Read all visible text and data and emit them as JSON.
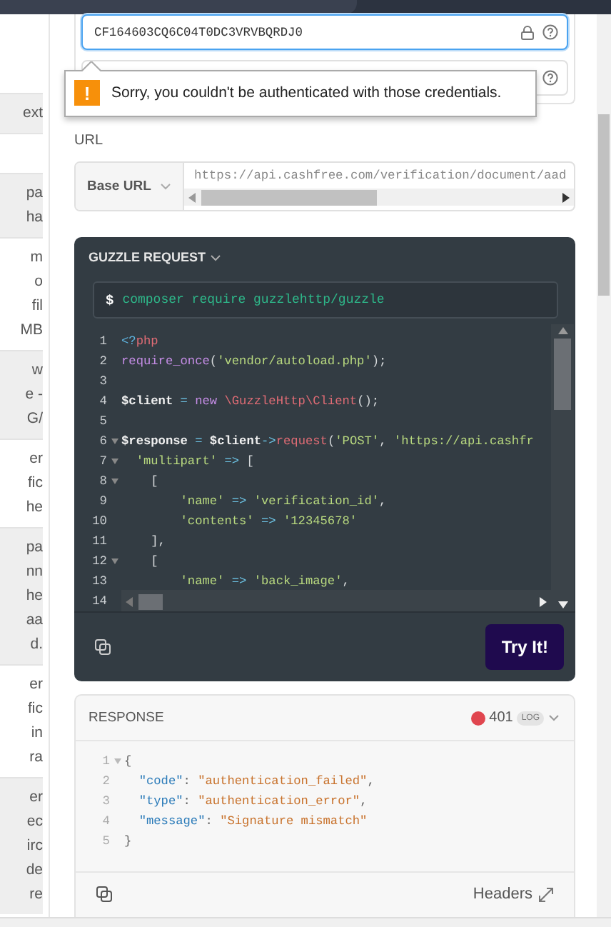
{
  "sidebar_fragments": [
    {
      "shaded": true,
      "lines": [
        "ext"
      ]
    },
    {
      "shaded": false
    },
    {
      "shaded": true,
      "lines": [
        "pa",
        "ha"
      ]
    },
    {
      "shaded": false,
      "lines": [
        "m",
        "o",
        "fil",
        "MB"
      ]
    },
    {
      "shaded": true,
      "lines": [
        "w",
        "e -",
        "G/"
      ]
    },
    {
      "shaded": false,
      "lines": [
        "er",
        "fic",
        "he"
      ]
    },
    {
      "shaded": true,
      "lines": [
        "pa",
        "nn",
        "he",
        "aa",
        "d."
      ]
    },
    {
      "shaded": false,
      "lines": [
        "er",
        "fic",
        "in",
        "ra"
      ]
    },
    {
      "shaded": true,
      "lines": [
        "er",
        "ec",
        "irc",
        "de",
        "re"
      ]
    }
  ],
  "credentials": {
    "fields": [
      {
        "value": "CF164603CQ6C04T0DC3VRVBQRDJ0",
        "focused": true,
        "locked": true
      },
      {
        "focused": false
      }
    ]
  },
  "error_tooltip": {
    "icon": "!",
    "message": "Sorry, you couldn't be authenticated with those credentials."
  },
  "url": {
    "label": "URL",
    "base_label": "Base URL",
    "value": "https://api.cashfree.com/verification/document/aad"
  },
  "request": {
    "title": "GUZZLE REQUEST",
    "prompt": "$",
    "command": "composer require guzzlehttp/guzzle",
    "button": "Try It!",
    "lines": [
      {
        "number": "1",
        "tokens": [
          {
            "kind": "tag",
            "text": "<?"
          },
          {
            "kind": "kw",
            "text": "php"
          }
        ]
      },
      {
        "number": "2",
        "tokens": [
          {
            "kind": "fn",
            "text": "require_once"
          },
          {
            "kind": "plain",
            "text": "("
          },
          {
            "kind": "str",
            "text": "'vendor/autoload.php'"
          },
          {
            "kind": "plain",
            "text": ");"
          }
        ]
      },
      {
        "number": "3"
      },
      {
        "number": "4",
        "tokens": [
          {
            "kind": "var",
            "text": "$client"
          },
          {
            "kind": "op",
            "text": " = "
          },
          {
            "kind": "fn",
            "text": "new"
          },
          {
            "kind": "kw",
            "text": " \\GuzzleHttp\\Client"
          },
          {
            "kind": "plain",
            "text": "();"
          }
        ]
      },
      {
        "number": "5"
      },
      {
        "number": "6",
        "foldable": true,
        "tokens": [
          {
            "kind": "var",
            "text": "$response"
          },
          {
            "kind": "op",
            "text": " = "
          },
          {
            "kind": "var",
            "text": "$client"
          },
          {
            "kind": "op",
            "text": "->"
          },
          {
            "kind": "kw",
            "text": "request"
          },
          {
            "kind": "plain",
            "text": "("
          },
          {
            "kind": "str",
            "text": "'POST'"
          },
          {
            "kind": "plain",
            "text": ", "
          },
          {
            "kind": "str",
            "text": "'https://api.cashfr"
          }
        ]
      },
      {
        "number": "7",
        "foldable": true,
        "tokens": [
          {
            "kind": "str",
            "text": "  'multipart'"
          },
          {
            "kind": "op",
            "text": " => "
          },
          {
            "kind": "plain",
            "text": "["
          }
        ]
      },
      {
        "number": "8",
        "foldable": true,
        "tokens": [
          {
            "kind": "plain",
            "text": "    ["
          }
        ]
      },
      {
        "number": "9",
        "tokens": [
          {
            "kind": "str",
            "text": "        'name'"
          },
          {
            "kind": "op",
            "text": " => "
          },
          {
            "kind": "str",
            "text": "'verification_id'"
          },
          {
            "kind": "plain",
            "text": ","
          }
        ]
      },
      {
        "number": "10",
        "tokens": [
          {
            "kind": "str",
            "text": "        'contents'"
          },
          {
            "kind": "op",
            "text": " => "
          },
          {
            "kind": "str",
            "text": "'12345678'"
          }
        ]
      },
      {
        "number": "11",
        "tokens": [
          {
            "kind": "plain",
            "text": "    ],"
          }
        ]
      },
      {
        "number": "12",
        "foldable": true,
        "tokens": [
          {
            "kind": "plain",
            "text": "    ["
          }
        ]
      },
      {
        "number": "13",
        "tokens": [
          {
            "kind": "str",
            "text": "        'name'"
          },
          {
            "kind": "op",
            "text": " => "
          },
          {
            "kind": "str",
            "text": "'back_image'"
          },
          {
            "kind": "plain",
            "text": ","
          }
        ]
      },
      {
        "number": "14"
      }
    ]
  },
  "response": {
    "title": "RESPONSE",
    "status": "401",
    "status_ok": false,
    "log_badge": "LOG",
    "headers_label": "Headers",
    "lines": [
      {
        "number": "1",
        "foldable": true,
        "tokens": [
          {
            "kind": "punct",
            "text": "{"
          }
        ]
      },
      {
        "number": "2",
        "tokens": [
          {
            "kind": "key",
            "text": "  \"code\""
          },
          {
            "kind": "punct",
            "text": ": "
          },
          {
            "kind": "str",
            "text": "\"authentication_failed\""
          },
          {
            "kind": "punct",
            "text": ","
          }
        ]
      },
      {
        "number": "3",
        "tokens": [
          {
            "kind": "key",
            "text": "  \"type\""
          },
          {
            "kind": "punct",
            "text": ": "
          },
          {
            "kind": "str",
            "text": "\"authentication_error\""
          },
          {
            "kind": "punct",
            "text": ","
          }
        ]
      },
      {
        "number": "4",
        "tokens": [
          {
            "kind": "key",
            "text": "  \"message\""
          },
          {
            "kind": "punct",
            "text": ": "
          },
          {
            "kind": "str",
            "text": "\"Signature mismatch\""
          }
        ]
      },
      {
        "number": "5",
        "tokens": [
          {
            "kind": "punct",
            "text": "}"
          }
        ]
      }
    ]
  }
}
